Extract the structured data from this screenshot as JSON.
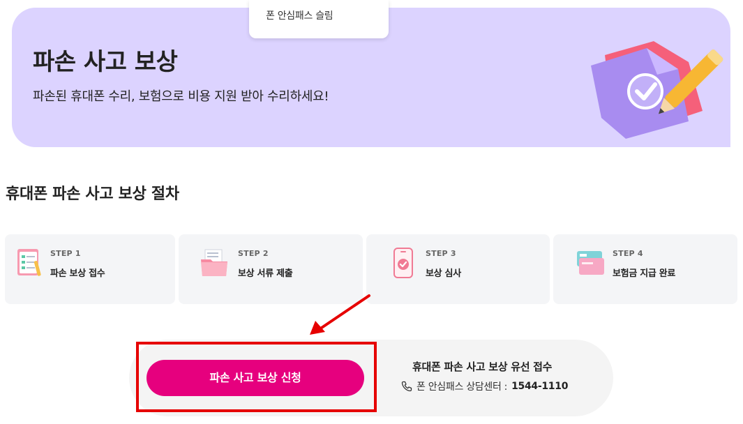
{
  "dropdown": {
    "item": "폰 안심패스 슬림"
  },
  "hero": {
    "title": "파손 사고 보상",
    "subtitle": "파손된 휴대폰 수리, 보험으로 비용 지원 받아 수리하세요!",
    "background": "#dcd3ff"
  },
  "section": {
    "title": "휴대폰 파손 사고 보상 절차"
  },
  "steps": [
    {
      "num": "STEP 1",
      "label": "파손 보상 접수",
      "icon": "checklist-notepad-icon"
    },
    {
      "num": "STEP 2",
      "label": "보상 서류 제출",
      "icon": "folder-documents-icon"
    },
    {
      "num": "STEP 3",
      "label": "보상 심사",
      "icon": "phone-check-icon"
    },
    {
      "num": "STEP 4",
      "label": "보험금 지급 완료",
      "icon": "cards-icon"
    }
  ],
  "cta": {
    "button": "파손 사고 보상 신청",
    "online_title": "휴대폰 파손 사고 보상 유선 접수",
    "phone_label": "폰 안심패스 상담센터 :",
    "phone_number": "1544-1110",
    "button_color": "#e6007e",
    "highlight_color": "#e60000"
  }
}
